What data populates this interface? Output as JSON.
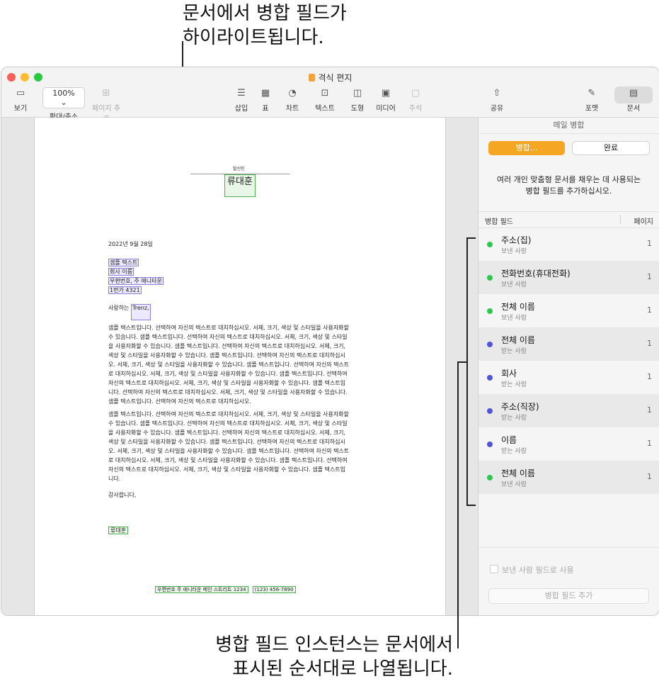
{
  "callouts": {
    "top_line1": "문서에서 병합 필드가",
    "top_line2": "하이라이트됩니다.",
    "bottom_line1": "병합 필드 인스턴스는 문서에서",
    "bottom_line2": "표시된 순서대로 나열됩니다."
  },
  "window": {
    "title": "격식 편지",
    "toolbar": {
      "view": "보기",
      "zoom_value": "100%",
      "zoom": "확대/축소",
      "add_page": "페이지 추가",
      "insert": "삽입",
      "table": "표",
      "chart": "차트",
      "text": "텍스트",
      "shape": "도형",
      "media": "미디어",
      "comment": "주석",
      "share": "공유",
      "format": "포맷",
      "document": "문서"
    }
  },
  "document": {
    "sender_label": "발신인",
    "sender_name": "류대훈",
    "date": "2022년 9월 28일",
    "address": [
      "샘플 텍스트",
      "회사 이름",
      "우편번호, 주 애니타운",
      "1번가 4321"
    ],
    "greeting_prefix": "사랑하는",
    "greeting_name": "Trenz,",
    "para1": [
      "샘플 텍스트입니다. 선택하여 자신의 텍스트로 대치하십시오. 서체, 크기, 색상 및 스타일을 사용자화할",
      "수 있습니다. 샘플 텍스트입니다. 선택하여 자신의 텍스트로 대치하십시오. 서체, 크기, 색상 및 스타일",
      "을 사용자화할 수 있습니다. 샘플 텍스트입니다. 선택하여 자신의 텍스트로 대치하십시오. 서체, 크기,",
      "색상 및 스타일을 사용자화할 수 있습니다. 샘플 텍스트입니다. 선택하여 자신의 텍스트로 대치하십시",
      "오. 서체, 크기, 색상 및 스타일을 사용자화할 수 있습니다. 샘플 텍스트입니다. 선택하여 자신의 텍스트",
      "로 대치하십시오. 서체, 크기, 색상 및 스타일을 사용자화할 수 있습니다. 샘플 텍스트입니다. 선택하여",
      "자신의 텍스트로 대치하십시오. 서체, 크기, 색상 및 스타일을 사용자화할 수 있습니다. 샘플 텍스트입",
      "니다. 선택하여 자신의 텍스트로 대치하십시오. 서체, 크기, 색상 및 스타일을 사용자화할 수 있습니다.",
      "샘플 텍스트입니다. 선택하여 자신의 텍스트로 대치하십시오."
    ],
    "para2": [
      "샘플 텍스트입니다. 선택하여 자신의 텍스트로 대치하십시오. 서체, 크기, 색상 및 스타일을 사용자화할",
      "수 있습니다. 샘플 텍스트입니다. 선택하여 자신의 텍스트로 대치하십시오. 서체, 크기, 색상 및 스타일",
      "을 사용자화할 수 있습니다. 샘플 텍스트입니다. 선택하여 자신의 텍스트로 대치하십시오. 서체, 크기,",
      "색상 및 스타일을 사용자화할 수 있습니다. 샘플 텍스트입니다. 선택하여 자신의 텍스트로 대치하십시",
      "오. 서체, 크기, 색상 및 스타일을 사용자화할 수 있습니다. 샘플 텍스트입니다. 선택하여 자신의 텍스트",
      "로 대치하십시오. 서체, 크기, 색상 및 스타일을 사용자화할 수 있습니다. 샘플 텍스트입니다. 선택하여",
      "자신의 텍스트로 대치하십시오. 서체, 크기, 색상 및 스타일을 사용자화할 수 있습니다. 샘플 텍스트입",
      "니다."
    ],
    "closing": "감사합니다,",
    "signature": "류대훈",
    "footer_address": "우편번호 주 애니타운   메인 스트리트 1234",
    "footer_phone": "(123) 456-7890"
  },
  "sidebar": {
    "header": "메일 병합",
    "merge_button": "병합...",
    "done_button": "완료",
    "description_line1": "여러 개인 맞춤형 문서를 채우는 데 사용되는",
    "description_line2": "병합 필드를 추가하십시오.",
    "col_field": "병합 필드",
    "col_page": "페이지",
    "rows": [
      {
        "name": "주소(집)",
        "sub": "보낸 사람",
        "page": "1",
        "color": "#2cc84d"
      },
      {
        "name": "전화번호(휴대전화)",
        "sub": "보낸 사람",
        "page": "1",
        "color": "#2cc84d"
      },
      {
        "name": "전체 이름",
        "sub": "보낸 사람",
        "page": "1",
        "color": "#2cc84d"
      },
      {
        "name": "전체 이름",
        "sub": "받는 사람",
        "page": "1",
        "color": "#5055d6"
      },
      {
        "name": "회사",
        "sub": "받는 사람",
        "page": "1",
        "color": "#5055d6"
      },
      {
        "name": "주소(직장)",
        "sub": "받는 사람",
        "page": "1",
        "color": "#5055d6"
      },
      {
        "name": "이름",
        "sub": "받는 사람",
        "page": "1",
        "color": "#5055d6"
      },
      {
        "name": "전체 이름",
        "sub": "보낸 사람",
        "page": "1",
        "color": "#2cc84d"
      }
    ],
    "use_sender_checkbox": "보낸 사람 필드로 사용",
    "add_field_button": "병합 필드 추가"
  }
}
